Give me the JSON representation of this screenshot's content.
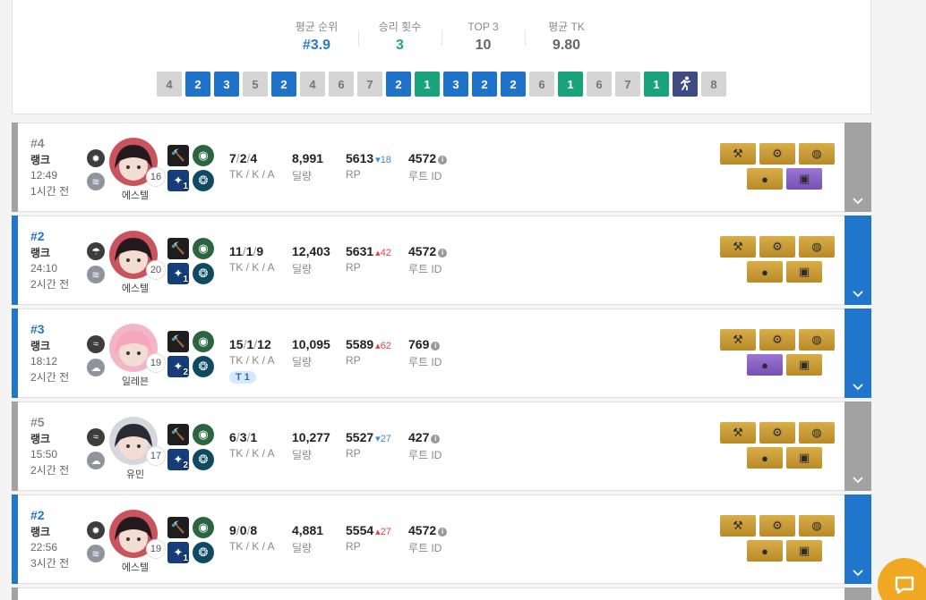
{
  "summary": {
    "stats": [
      {
        "label": "평균 순위",
        "value": "#3.9",
        "tone": "blue"
      },
      {
        "label": "승리 횟수",
        "value": "3",
        "tone": "green"
      },
      {
        "label": "TOP 3",
        "value": "10",
        "tone": "plain"
      },
      {
        "label": "평균 TK",
        "value": "9.80",
        "tone": "plain"
      }
    ],
    "recent_ranks": [
      {
        "label": "4",
        "tone": "gray"
      },
      {
        "label": "2",
        "tone": "blue"
      },
      {
        "label": "3",
        "tone": "blue"
      },
      {
        "label": "5",
        "tone": "gray"
      },
      {
        "label": "2",
        "tone": "blue"
      },
      {
        "label": "4",
        "tone": "gray"
      },
      {
        "label": "6",
        "tone": "gray"
      },
      {
        "label": "7",
        "tone": "gray"
      },
      {
        "label": "2",
        "tone": "blue"
      },
      {
        "label": "1",
        "tone": "green"
      },
      {
        "label": "3",
        "tone": "blue"
      },
      {
        "label": "2",
        "tone": "blue"
      },
      {
        "label": "2",
        "tone": "blue"
      },
      {
        "label": "6",
        "tone": "gray"
      },
      {
        "label": "1",
        "tone": "green"
      },
      {
        "label": "6",
        "tone": "gray"
      },
      {
        "label": "7",
        "tone": "gray"
      },
      {
        "label": "1",
        "tone": "green"
      },
      {
        "label": "",
        "tone": "navy",
        "icon": "running-person-icon"
      },
      {
        "label": "8",
        "tone": "gray"
      }
    ]
  },
  "labels": {
    "kda_sub": "TK / K / A",
    "damage_sub": "딜량",
    "rp_sub": "RP",
    "route_sub": "루트 ID"
  },
  "matches": [
    {
      "rank": "#4",
      "mode": "랭크",
      "duration": "12:49",
      "ago": "1시간 전",
      "tone": "gray",
      "weather": [
        "sun-icon",
        "wind-icon"
      ],
      "character": "에스텔",
      "level": "16",
      "skill_badges": [
        "",
        "",
        "1",
        ""
      ],
      "tk": "7",
      "k": "2",
      "a": "4",
      "tag": "",
      "damage": "8,991",
      "rp": "5613",
      "rp_delta": "18",
      "rp_dir": "down",
      "route": "4572",
      "items": [
        "gold",
        "gold",
        "gold",
        "gold",
        "purple"
      ]
    },
    {
      "rank": "#2",
      "mode": "랭크",
      "duration": "24:10",
      "ago": "2시간 전",
      "tone": "blue",
      "weather": [
        "rain-cloud-icon",
        "wind-icon"
      ],
      "character": "에스텔",
      "level": "20",
      "skill_badges": [
        "",
        "",
        "1",
        ""
      ],
      "tk": "11",
      "k": "1",
      "a": "9",
      "tag": "",
      "damage": "12,403",
      "rp": "5631",
      "rp_delta": "42",
      "rp_dir": "up",
      "route": "4572",
      "items": [
        "gold",
        "gold",
        "gold",
        "gold",
        "gold"
      ]
    },
    {
      "rank": "#3",
      "mode": "랭크",
      "duration": "18:12",
      "ago": "2시간 전",
      "tone": "blue",
      "weather": [
        "wifi-icon",
        "cloud-hail-icon"
      ],
      "character": "일레븐",
      "level": "19",
      "skill_badges": [
        "",
        "",
        "2",
        ""
      ],
      "tk": "15",
      "k": "1",
      "a": "12",
      "tag": "T 1",
      "damage": "10,095",
      "rp": "5589",
      "rp_delta": "62",
      "rp_dir": "up",
      "route": "769",
      "items": [
        "gold",
        "gold",
        "gold",
        "purple",
        "gold"
      ]
    },
    {
      "rank": "#5",
      "mode": "랭크",
      "duration": "15:50",
      "ago": "2시간 전",
      "tone": "gray",
      "weather": [
        "wifi-icon",
        "cloud-hail-icon"
      ],
      "character": "유민",
      "level": "17",
      "skill_badges": [
        "",
        "",
        "2",
        ""
      ],
      "tk": "6",
      "k": "3",
      "a": "1",
      "tag": "",
      "damage": "10,277",
      "rp": "5527",
      "rp_delta": "27",
      "rp_dir": "down",
      "route": "427",
      "items": [
        "gold",
        "gold",
        "gold",
        "gold",
        "gold"
      ]
    },
    {
      "rank": "#2",
      "mode": "랭크",
      "duration": "22:56",
      "ago": "3시간 전",
      "tone": "blue",
      "weather": [
        "sun-icon",
        "wind-icon"
      ],
      "character": "에스텔",
      "level": "19",
      "skill_badges": [
        "",
        "",
        "1",
        ""
      ],
      "tk": "9",
      "k": "0",
      "a": "8",
      "tag": "",
      "damage": "4,881",
      "rp": "5554",
      "rp_delta": "27",
      "rp_dir": "up",
      "route": "4572",
      "items": [
        "gold",
        "gold",
        "gold",
        "gold",
        "gold"
      ]
    }
  ]
}
